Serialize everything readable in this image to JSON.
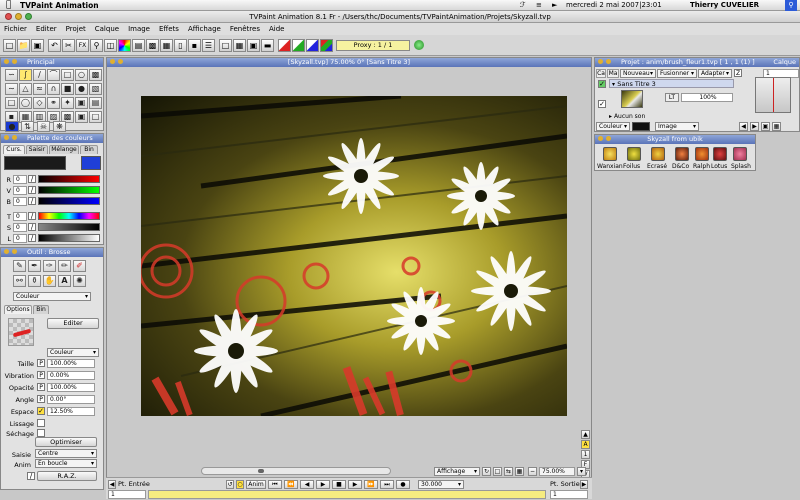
{
  "menubar": {
    "app_name": "TVPaint Animation",
    "clock": "mercredi 2 mai 2007|23:01",
    "user": "Thierry CUVELIER"
  },
  "window": {
    "title": "TVPaint Animation 8.1 Fr - /Users/thc/Documents/TVPaintAnimation/Projets/Skyzall.tvp"
  },
  "menu": {
    "items": [
      "Fichier",
      "Editer",
      "Projet",
      "Calque",
      "Image",
      "Effets",
      "Affichage",
      "Fenêtres",
      "Aide"
    ]
  },
  "toolbar": {
    "proxy_label": "Proxy : 1 / 1"
  },
  "principal": {
    "title": "Principal"
  },
  "palette": {
    "title": "Palette des couleurs",
    "tabs": [
      "Curs.",
      "Saisir",
      "Mélange",
      "Bin"
    ],
    "channels": [
      {
        "label": "R",
        "value": "0"
      },
      {
        "label": "V",
        "value": "0"
      },
      {
        "label": "B",
        "value": "0"
      },
      {
        "label": "T",
        "value": "0"
      },
      {
        "label": "S",
        "value": "0"
      },
      {
        "label": "L",
        "value": "0"
      }
    ],
    "primary_color": "#1a1a1a",
    "secondary_color": "#1f3fd8"
  },
  "brush": {
    "title": "Outil : Brosse",
    "mode_select": "Couleur",
    "tabs": [
      "Options",
      "Bin"
    ],
    "edit_button": "Editer",
    "mode2_select": "Couleur",
    "params": [
      {
        "label": "Taille",
        "value": "100.00%"
      },
      {
        "label": "Vibration",
        "value": "0.00%"
      },
      {
        "label": "Opacité",
        "value": "100.00%"
      },
      {
        "label": "Angle",
        "value": "0.00°"
      },
      {
        "label": "Espace",
        "value": "12.50%"
      }
    ],
    "lissage": "Lissage",
    "sechage": "Séchage",
    "optimize_button": "Optimiser",
    "saisie_label": "Saisie",
    "saisie_value": "Centre",
    "anim_label": "Anim",
    "anim_value": "En boucle",
    "raz_button": "R.A.Z."
  },
  "canvas": {
    "title": "[Skyzall.tvp]   75.00%   0°  [Sans Titre 3]",
    "display_select": "Affichage",
    "zoom": "75.00%",
    "side_labels": [
      "A",
      "1",
      "F",
      "V"
    ]
  },
  "timeline": {
    "in_label": "Pt. Entrée",
    "in_value": "1",
    "anim_button": "Anim",
    "framerate": "30.000",
    "out_label": "Pt. Sortie",
    "out_value": "1"
  },
  "project": {
    "title": "Projet : anim/brush_fleur1.tvp [ 1 , 1  (1) ]",
    "right_label": "Calque",
    "col_headers": [
      "Ca",
      "Ma",
      "Nouveau",
      "Fusionner",
      "Adapter"
    ],
    "layer_name": "Sans Titre 3",
    "layer_opacity": "100%",
    "layer_frame": "1",
    "sound_label": "Aucun son",
    "couleur_label": "Couleur",
    "image_select": "Image",
    "lt_label": "LT"
  },
  "skyzall": {
    "title": "Skyzall from ubik",
    "tools": [
      "Wanxian",
      "Foilus",
      "Ecrasé",
      "D&Co",
      "Ralph",
      "Lotus",
      "Splash"
    ]
  }
}
